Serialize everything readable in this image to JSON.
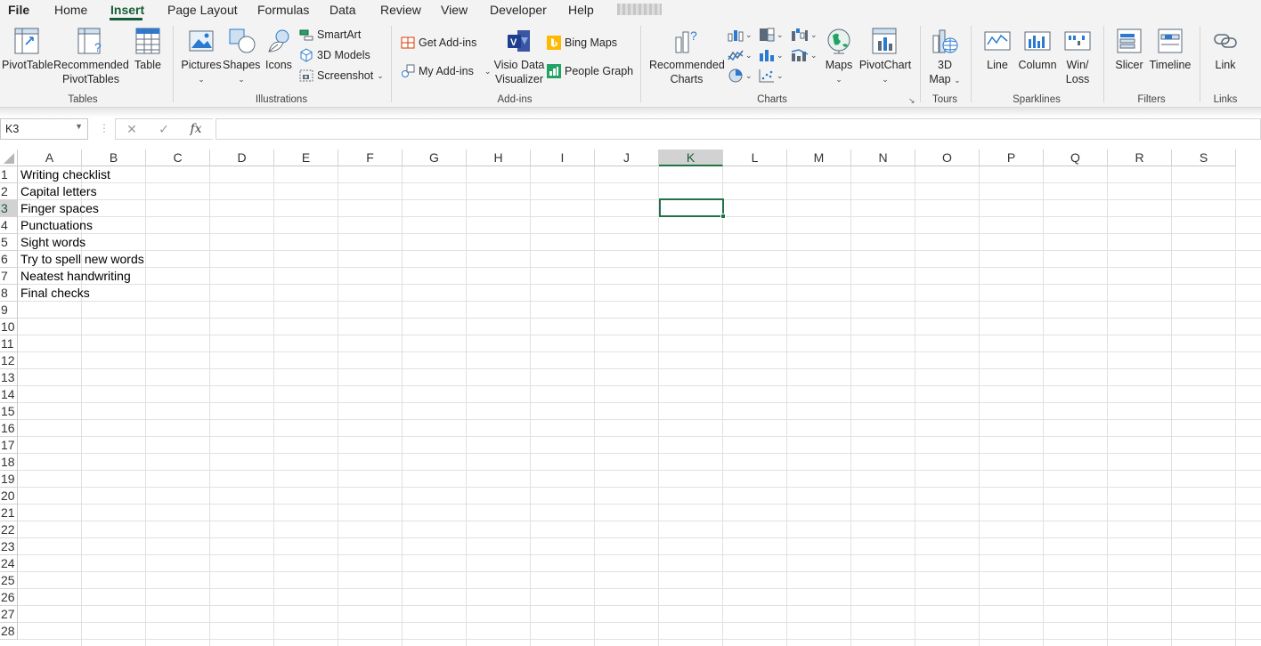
{
  "menu": {
    "tabs": [
      "File",
      "Home",
      "Insert",
      "Page Layout",
      "Formulas",
      "Data",
      "Review",
      "View",
      "Developer",
      "Help"
    ],
    "active_tab": "Insert"
  },
  "ribbon": {
    "tables": {
      "group_label": "Tables",
      "pivottable": "PivotTable",
      "recommended_pivottables_1": "Recommended",
      "recommended_pivottables_2": "PivotTables",
      "table": "Table"
    },
    "illustrations": {
      "group_label": "Illustrations",
      "pictures": "Pictures",
      "shapes": "Shapes",
      "icons": "Icons",
      "smartart": "SmartArt",
      "models_3d": "3D Models",
      "screenshot": "Screenshot"
    },
    "addins": {
      "group_label": "Add-ins",
      "get_addins": "Get Add-ins",
      "my_addins": "My Add-ins",
      "visio_1": "Visio Data",
      "visio_2": "Visualizer",
      "bing_maps": "Bing Maps",
      "people_graph": "People Graph"
    },
    "charts": {
      "group_label": "Charts",
      "recommended_charts_1": "Recommended",
      "recommended_charts_2": "Charts",
      "maps": "Maps",
      "pivotchart": "PivotChart"
    },
    "tours": {
      "group_label": "Tours",
      "map3d_1": "3D",
      "map3d_2": "Map"
    },
    "sparklines": {
      "group_label": "Sparklines",
      "line": "Line",
      "column": "Column",
      "winloss_1": "Win/",
      "winloss_2": "Loss"
    },
    "filters": {
      "group_label": "Filters",
      "slicer": "Slicer",
      "timeline": "Timeline"
    },
    "links": {
      "group_label": "Links",
      "link": "Link"
    }
  },
  "formula_bar": {
    "name_box": "K3",
    "fx": "fx",
    "cancel": "✕",
    "enter": "✓",
    "value": ""
  },
  "sheet": {
    "columns": [
      "A",
      "B",
      "C",
      "D",
      "E",
      "F",
      "G",
      "H",
      "I",
      "J",
      "K",
      "L",
      "M",
      "N",
      "O",
      "P",
      "Q",
      "R",
      "S"
    ],
    "rows": [
      "1",
      "2",
      "3",
      "4",
      "5",
      "6",
      "7",
      "8",
      "9",
      "10",
      "11",
      "12",
      "13",
      "14",
      "15",
      "16",
      "17",
      "18",
      "19",
      "20",
      "21",
      "22",
      "23",
      "24",
      "25",
      "26",
      "27",
      "28"
    ],
    "selected_cell": "K3",
    "column_a": [
      "Writing checklist",
      "Capital letters",
      "Finger spaces",
      "Punctuations",
      "Sight words",
      "Try to spell new words",
      "Neatest handwriting",
      "Final checks"
    ]
  },
  "colors": {
    "accent": "#217346",
    "accent_text": "#185c37"
  }
}
